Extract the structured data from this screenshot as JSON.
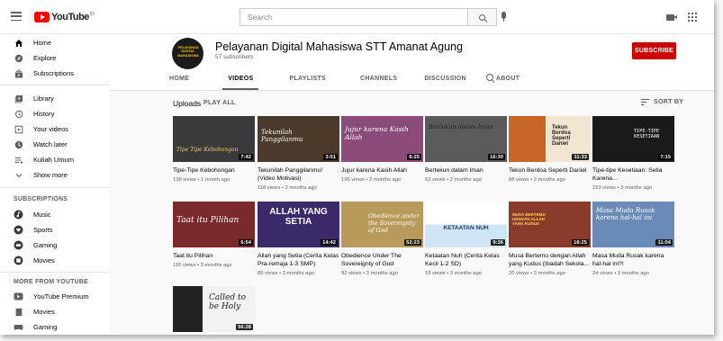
{
  "topbar": {
    "brand": "YouTube",
    "brand_region": "ID",
    "search_placeholder": "Search",
    "icons": [
      "hamburger-icon",
      "search-icon",
      "mic-icon",
      "create-video-icon",
      "apps-icon"
    ]
  },
  "sidebar": {
    "main": [
      {
        "label": "Home",
        "icon": "home-icon"
      },
      {
        "label": "Explore",
        "icon": "explore-icon"
      },
      {
        "label": "Subscriptions",
        "icon": "subscriptions-icon"
      }
    ],
    "library": [
      {
        "label": "Library",
        "icon": "library-icon"
      },
      {
        "label": "History",
        "icon": "history-icon"
      },
      {
        "label": "Your videos",
        "icon": "your-videos-icon"
      },
      {
        "label": "Watch later",
        "icon": "watch-later-icon"
      },
      {
        "label": "Kuliah Umum",
        "icon": "playlist-icon"
      },
      {
        "label": "Show more",
        "icon": "chevron-down-icon"
      }
    ],
    "subscriptions_heading": "SUBSCRIPTIONS",
    "subscriptions": [
      {
        "label": "Music",
        "icon": "music-icon"
      },
      {
        "label": "Sports",
        "icon": "sports-icon"
      },
      {
        "label": "Gaming",
        "icon": "gaming-icon"
      },
      {
        "label": "Movies",
        "icon": "movies-icon"
      }
    ],
    "more_heading": "MORE FROM YOUTUBE",
    "more": [
      {
        "label": "YouTube Premium",
        "icon": "youtube-premium-icon"
      },
      {
        "label": "Movies",
        "icon": "movies-film-icon"
      },
      {
        "label": "Gaming",
        "icon": "gaming-controller-icon"
      }
    ]
  },
  "channel": {
    "avatar_text": "PELAYANAN DIGITAL MAHASISWA",
    "name": "Pelayanan Digital Mahasiswa STT Amanat Agung",
    "subscribers": "57 subscribers",
    "subscribe_label": "SUBSCRIBE",
    "tabs": [
      "HOME",
      "VIDEOS",
      "PLAYLISTS",
      "CHANNELS",
      "DISCUSSION",
      "ABOUT"
    ],
    "active_tab": "VIDEOS"
  },
  "section": {
    "title": "Uploads",
    "play_all": "PLAY ALL",
    "sort_by": "SORT BY"
  },
  "videos": [
    {
      "title": "Tipe-Tipe Kebohongan",
      "meta": "138 views • 1 month ago",
      "duration": "7:42",
      "thumb_text": "Tipe Tipe Kebohongan",
      "color": "#3a3a3a"
    },
    {
      "title": "Tekunilah Panggilanmu! (Video Motivasi)",
      "meta": "118 views • 2 months ago",
      "duration": "3:51",
      "thumb_text": "Tekunilah Panggilanmu",
      "color": "#4a3a2a"
    },
    {
      "title": "Jujur karena Kasih Allah",
      "meta": "196 views • 2 months ago",
      "duration": "6:25",
      "thumb_text": "Jujur karena Kasih Allah",
      "color": "#8a4a7a"
    },
    {
      "title": "Bertekun dalam Iman",
      "meta": "53 views • 2 months ago",
      "duration": "16:30",
      "thumb_text": "Bertekun dalam Iman",
      "color": "#5a5a5a"
    },
    {
      "title": "Tekun Berdoa Seperti Daniel",
      "meta": "88 views • 2 months ago",
      "duration": "11:33",
      "thumb_text": "Tekun Berdoa Seperti Daniel",
      "color": "#c8662a"
    },
    {
      "title": "Tipe-tipe Kesetiaan: Setia Karena...",
      "meta": "153 views • 3 months ago",
      "duration": "7:15",
      "thumb_text": "TIPE-TIPE KESETIAAN",
      "color": "#1a1a1a"
    },
    {
      "title": "Taat itu Pilihan",
      "meta": "116 views • 3 months ago",
      "duration": "6:54",
      "thumb_text": "Taat itu Pilihan",
      "color": "#7a2a2a"
    },
    {
      "title": "Allah yang Setia (Cerita Kelas Pra-remaja 1-3 SMP)",
      "meta": "86 views • 3 months ago",
      "duration": "14:42",
      "thumb_text": "ALLAH YANG SETIA",
      "color": "#3a2a6a"
    },
    {
      "title": "Obedience Under The Sovereignty of God",
      "meta": "92 views • 3 months ago",
      "duration": "52:23",
      "thumb_text": "Obedience under the Sovereignty of God",
      "color": "#b89a5a"
    },
    {
      "title": "Ketaatan Nuh (Cerita Kelas Kecil 1-2 SD)",
      "meta": "18 views • 3 months ago",
      "duration": "9:36",
      "thumb_text": "KETAATAN NUH",
      "color": "#e8e8e8"
    },
    {
      "title": "Musa Bertemu dengan Allah yang Kudus (Ibadah Sekola...",
      "meta": "20 views • 3 months ago",
      "duration": "18:25",
      "thumb_text": "MUSA BERTEMU DENGAN ALLAH YANG KUDUS",
      "color": "#8a3a2a"
    },
    {
      "title": "Masa Muda Rusak karena hal-hal ini?!",
      "meta": "24 views • 3 months ago",
      "duration": "11:04",
      "thumb_text": "Masa Muda Rusak karena hal-hal ini",
      "color": "#6a8ab8"
    },
    {
      "title": "",
      "meta": "",
      "duration": "56:28",
      "thumb_text": "Called to be Holy",
      "color": "#2a2a2a"
    }
  ]
}
